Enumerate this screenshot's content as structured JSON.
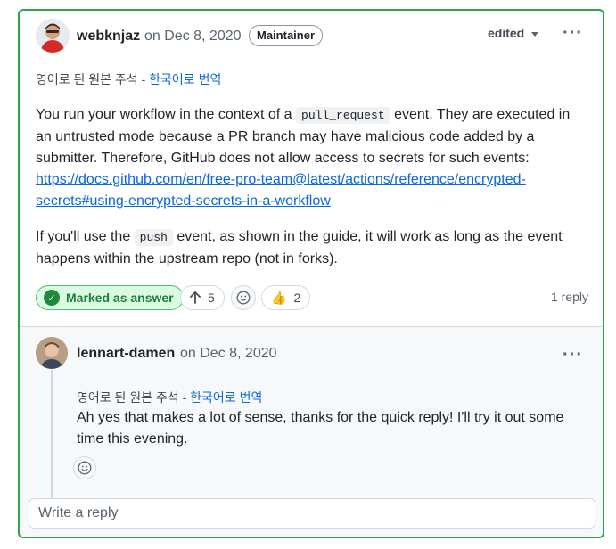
{
  "comment": {
    "author": "webknjaz",
    "date": "on Dec 8, 2020",
    "badge": "Maintainer",
    "edited": "edited",
    "original_note": "영어로 된 원본 주석",
    "note_sep": " - ",
    "translate_link": "한국어로 번역",
    "p1_a": "You run your workflow in the context of a ",
    "p1_code": "pull_request",
    "p1_b": " event. They are executed in an untrusted mode because a PR branch may have malicious code added by a submitter. Therefore, GitHub does not allow access to secrets for such events: ",
    "p1_link": "https://docs.github.com/en/free-pro-team@latest/actions/reference/encrypted-secrets#using-encrypted-secrets-in-a-workflow",
    "p2_a": "If you'll use the ",
    "p2_code": "push",
    "p2_b": " event, as shown in the guide, it will work as long as the event happens within the upstream repo (not in forks).",
    "answer_label": "Marked as answer",
    "upvotes": "5",
    "thumbs_count": "2",
    "reply_count": "1 reply"
  },
  "reply": {
    "author": "lennart-damen",
    "date": "on Dec 8, 2020",
    "original_note": "영어로 된 원본 주석",
    "note_sep": " - ",
    "translate_link": "한국어로 번역",
    "text": "Ah yes that makes a lot of sense, thanks for the quick reply! I'll try it out some time this evening."
  },
  "reply_box": {
    "placeholder": "Write a reply"
  },
  "colors": {
    "accent_green": "#2da44e",
    "link_blue": "#0969da",
    "muted": "#59636e"
  },
  "icons": [
    "avatar-webknjaz",
    "kebab-icon",
    "check-icon",
    "arrow-up-icon",
    "smiley-icon",
    "thumbs-up-icon",
    "avatar-lennart"
  ]
}
